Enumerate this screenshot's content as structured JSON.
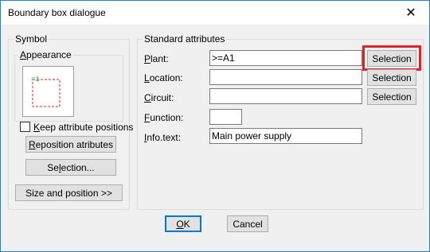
{
  "window": {
    "title": "Boundary box dialogue",
    "close_glyph": "✕"
  },
  "symbol_group": {
    "title": "Symbol",
    "appearance": {
      "title": "Appearance",
      "preview_label": "=1"
    },
    "keep_positions": {
      "label": "Keep attribute positions",
      "checked": false
    },
    "reposition_button": "Reposition atributes",
    "selection_button": "Selection...",
    "size_button": "Size and position >>"
  },
  "attributes_group": {
    "title": "Standard attributes",
    "fields": [
      {
        "label": "Plant:",
        "value": ">=A1",
        "button": "Selection"
      },
      {
        "label": "Location:",
        "value": "",
        "button": "Selection"
      },
      {
        "label": "Circuit:",
        "value": "",
        "button": "Selection"
      },
      {
        "label": "Function:",
        "value": ""
      },
      {
        "label": "Info.text:",
        "value": "Main power supply"
      }
    ]
  },
  "footer": {
    "ok": "OK",
    "cancel": "Cancel"
  },
  "colors": {
    "highlight": "#e0202a",
    "accent": "#0078d7",
    "preview_green": "#19b319",
    "preview_red": "#e0202a"
  }
}
